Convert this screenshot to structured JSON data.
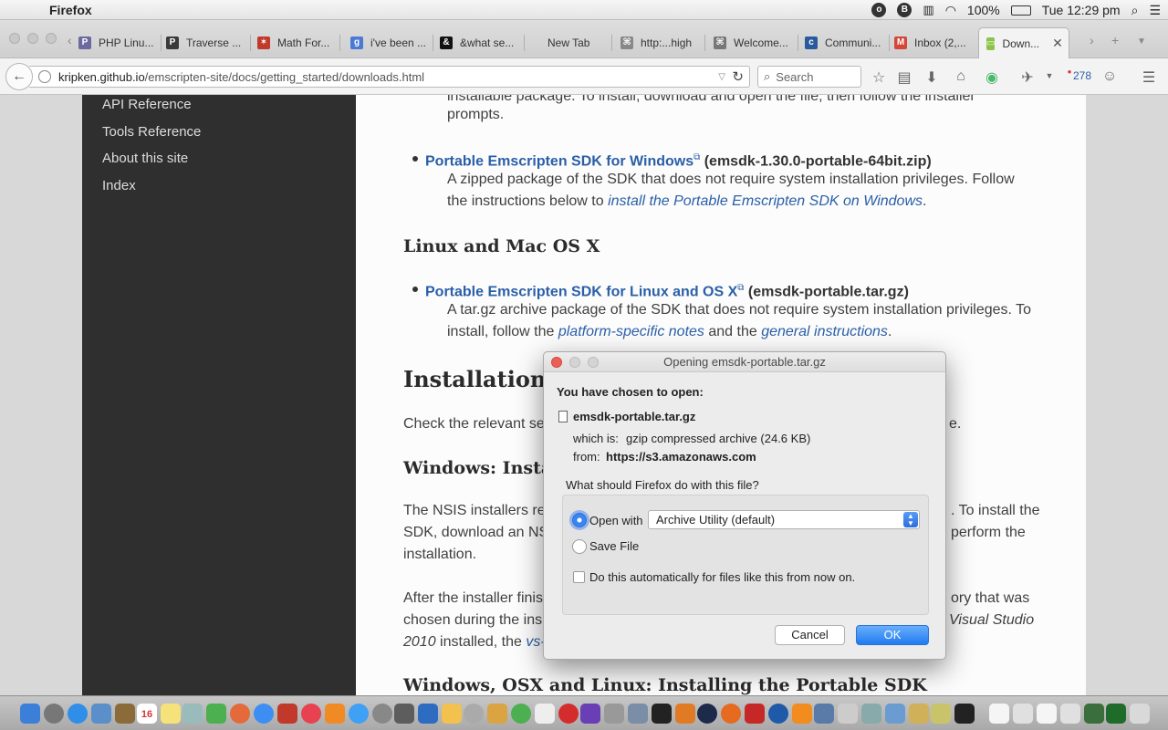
{
  "menubar": {
    "app_name": "Firefox",
    "battery": "100%",
    "clock": "Tue 12:29 pm"
  },
  "tabs": [
    {
      "label": "PHP Linu...",
      "color": "#6a6a9e"
    },
    {
      "label": "Traverse ...",
      "color": "#3a3a3a"
    },
    {
      "label": "Math For...",
      "color": "#c0392b"
    },
    {
      "label": "i've been ...",
      "color": "#4a7ad6"
    },
    {
      "label": "&what se...",
      "color": "#111111"
    },
    {
      "label": "New Tab",
      "color": ""
    },
    {
      "label": "http:...high",
      "color": "#888888"
    },
    {
      "label": "Welcome...",
      "color": "#777777"
    },
    {
      "label": "Communi...",
      "color": "#2a5a9c"
    },
    {
      "label": "Inbox (2,...",
      "color": "#d44638"
    },
    {
      "label": "Down...",
      "color": "#8bc34a"
    }
  ],
  "navbar": {
    "url_host": "kripken.github.io",
    "url_path": "/emscripten-site/docs/getting_started/downloads.html",
    "search_placeholder": "Search",
    "badge_count": "278"
  },
  "sidebar": {
    "items": [
      "API Reference",
      "Tools Reference",
      "About this site",
      "Index"
    ]
  },
  "content": {
    "top_text_1": "installable package. To install, download and open the file, then follow the installer",
    "top_text_2": "prompts.",
    "win_link": "Portable Emscripten SDK for Windows",
    "win_file": "(emsdk-1.30.0-portable-64bit.zip)",
    "win_desc_1": "A zipped package of the SDK that does not require system installation privileges. Follow",
    "win_desc_2a": "the instructions below to ",
    "win_desc_2b": "install the Portable Emscripten SDK on Windows",
    "win_desc_2c": ".",
    "heading_linux": "Linux and Mac OS X",
    "linux_link": "Portable Emscripten SDK for Linux and OS X",
    "linux_file": "(emsdk-portable.tar.gz)",
    "linux_desc_1": "A tar.gz archive package of the SDK that does not require system installation privileges. To",
    "linux_desc_2a": "install, follow the ",
    "linux_desc_2b": "platform-specific notes",
    "linux_desc_2c": " and the ",
    "linux_desc_2d": "general instructions",
    "linux_desc_2e": ".",
    "heading_install": "Installation in",
    "check_text_a": "Check the relevant se",
    "check_text_b": "e.",
    "heading_windows": "Windows: Install",
    "nsis_1a": "The NSIS installers re",
    "nsis_1b": ". To install the",
    "nsis_2a": "SDK, download an NS",
    "nsis_2b": "perform the",
    "nsis_3": "installation.",
    "after_1a": "After the installer finis",
    "after_1b": "ory that was",
    "after_2a": "chosen during the ins",
    "after_2b": "Visual Studio",
    "after_3a": "2010",
    "after_3b": " installed, the ",
    "after_3c": "vs-",
    "heading_portable": "Windows, OSX and Linux: Installing the Portable SDK"
  },
  "dialog": {
    "title": "Opening emsdk-portable.tar.gz",
    "chosen_label": "You have chosen to open:",
    "filename": "emsdk-portable.tar.gz",
    "which_is_label": "which is:",
    "which_is_value": "gzip compressed archive (24.6 KB)",
    "from_label": "from:",
    "from_value": "https://s3.amazonaws.com",
    "question": "What should Firefox do with this file?",
    "open_with_label": "Open with",
    "open_with_value": "Archive Utility (default)",
    "save_file_label": "Save File",
    "auto_label": "Do this automatically for files like this from now on.",
    "cancel_label": "Cancel",
    "ok_label": "OK"
  },
  "dock": {
    "calendar_day": "16"
  }
}
